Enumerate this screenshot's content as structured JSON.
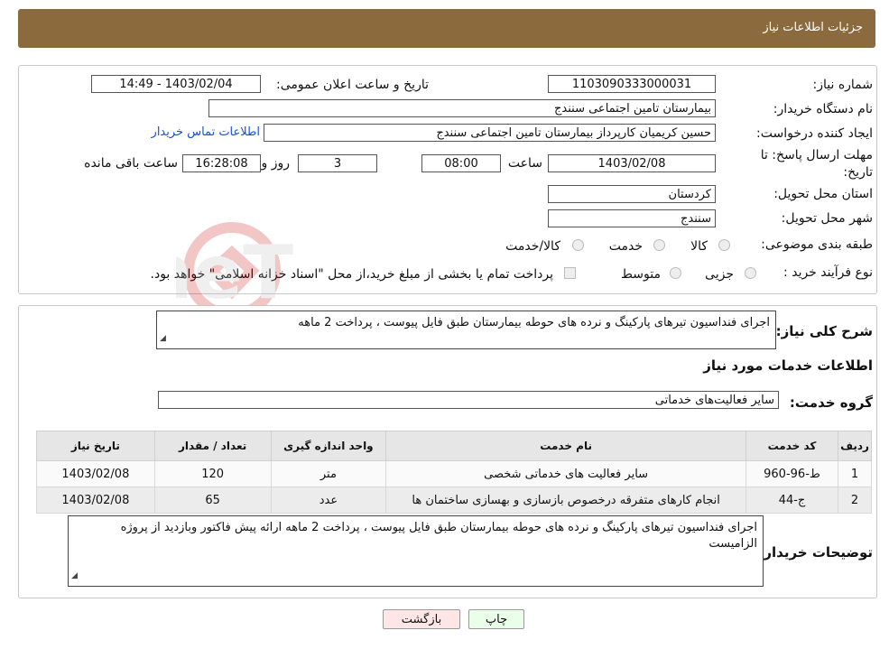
{
  "header": {
    "title": "جزئیات اطلاعات نیاز"
  },
  "form": {
    "need_number_label": "شماره نیاز:",
    "need_number": "1103090333000031",
    "announce_label": "تاریخ و ساعت اعلان عمومی:",
    "announce_value": "1403/02/04 - 14:49",
    "buyer_org_label": "نام دستگاه خریدار:",
    "buyer_org": "بیمارستان تامین اجتماعی سنندج",
    "creator_label": "ایجاد کننده درخواست:",
    "creator": "حسین کریمیان کارپرداز بیمارستان تامین اجتماعی سنندج",
    "contact_link": "اطلاعات تماس خریدار",
    "deadline_label_1": "مهلت ارسال پاسخ: تا",
    "deadline_label_2": "تاریخ:",
    "deadline_date": "1403/02/08",
    "time_label": "ساعت",
    "deadline_time": "08:00",
    "days": "3",
    "days_label": "روز و",
    "remaining_time": "16:28:08",
    "remaining_label": "ساعت باقی مانده",
    "province_label": "استان محل تحویل:",
    "province": "کردستان",
    "city_label": "شهر محل تحویل:",
    "city": "سنندج",
    "category_label": "طبقه بندی موضوعی:",
    "category_options": [
      "کالا",
      "خدمت",
      "کالا/خدمت"
    ],
    "purchase_type_label": "نوع فرآیند خرید :",
    "purchase_options": [
      "جزیی",
      "متوسط"
    ],
    "purchase_note": "پرداخت تمام یا بخشی از مبلغ خرید،از محل \"اسناد خزانه اسلامی\" خواهد بود."
  },
  "details": {
    "description_label": "شرح کلی نیاز:",
    "description": "اجرای فنداسیون تیرهای پارکینگ  و نرده های حوطه بیمارستان طبق فایل پیوست ، پرداخت 2 ماهه",
    "services_title": "اطلاعات خدمات مورد نیاز",
    "service_group_label": "گروه خدمت:",
    "service_group": "سایر فعالیت‌های خدماتی",
    "table": {
      "headers": [
        "ردیف",
        "کد خدمت",
        "نام خدمت",
        "واحد اندازه گیری",
        "تعداد / مقدار",
        "تاریخ نیاز"
      ],
      "rows": [
        [
          "1",
          "ط-96-960",
          "سایر فعالیت های خدماتی شخصی",
          "متر",
          "120",
          "1403/02/08"
        ],
        [
          "2",
          "ج-44",
          "انجام کارهای متفرقه درخصوص بازسازی و بهسازی ساختمان ها",
          "عدد",
          "65",
          "1403/02/08"
        ]
      ]
    },
    "buyer_notes_label": "توضیحات خریدار:",
    "buyer_notes": "اجرای فنداسیون تیرهای پارکینگ  و نرده های حوطه بیمارستان طبق فایل پیوست ، پرداخت 2 ماهه ارائه پیش فاکتور وبازدید از پروژه الزامیست"
  },
  "buttons": {
    "print": "چاپ",
    "back": "بازگشت"
  },
  "watermark_text": "AriaTender.neT",
  "colors": {
    "header_bg": "#8b6a3e",
    "link": "#1a4fd6",
    "print_bg": "#eaffea",
    "back_bg": "#ffe6e6"
  }
}
